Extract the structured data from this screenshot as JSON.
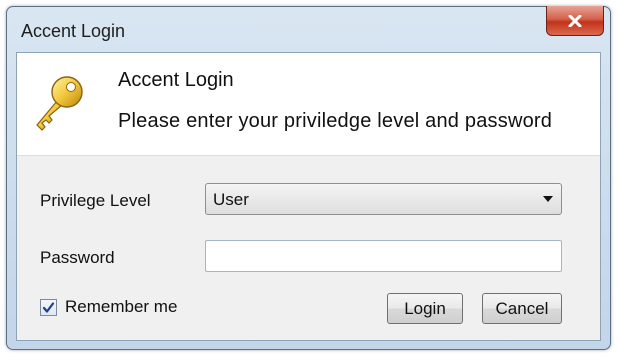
{
  "window": {
    "title": "Accent Login"
  },
  "header": {
    "title": "Accent Login",
    "subtitle": "Please enter your priviledge level and password"
  },
  "form": {
    "privilege_label": "Privilege Level",
    "privilege_value": "User",
    "password_label": "Password",
    "password_value": "",
    "remember_label": "Remember me",
    "remember_checked": true
  },
  "buttons": {
    "login_label": "Login",
    "cancel_label": "Cancel"
  },
  "icons": {
    "header": "key-icon",
    "close": "close-icon"
  },
  "colors": {
    "close_button": "#c2321a",
    "checkmark": "#1f3f8a"
  }
}
